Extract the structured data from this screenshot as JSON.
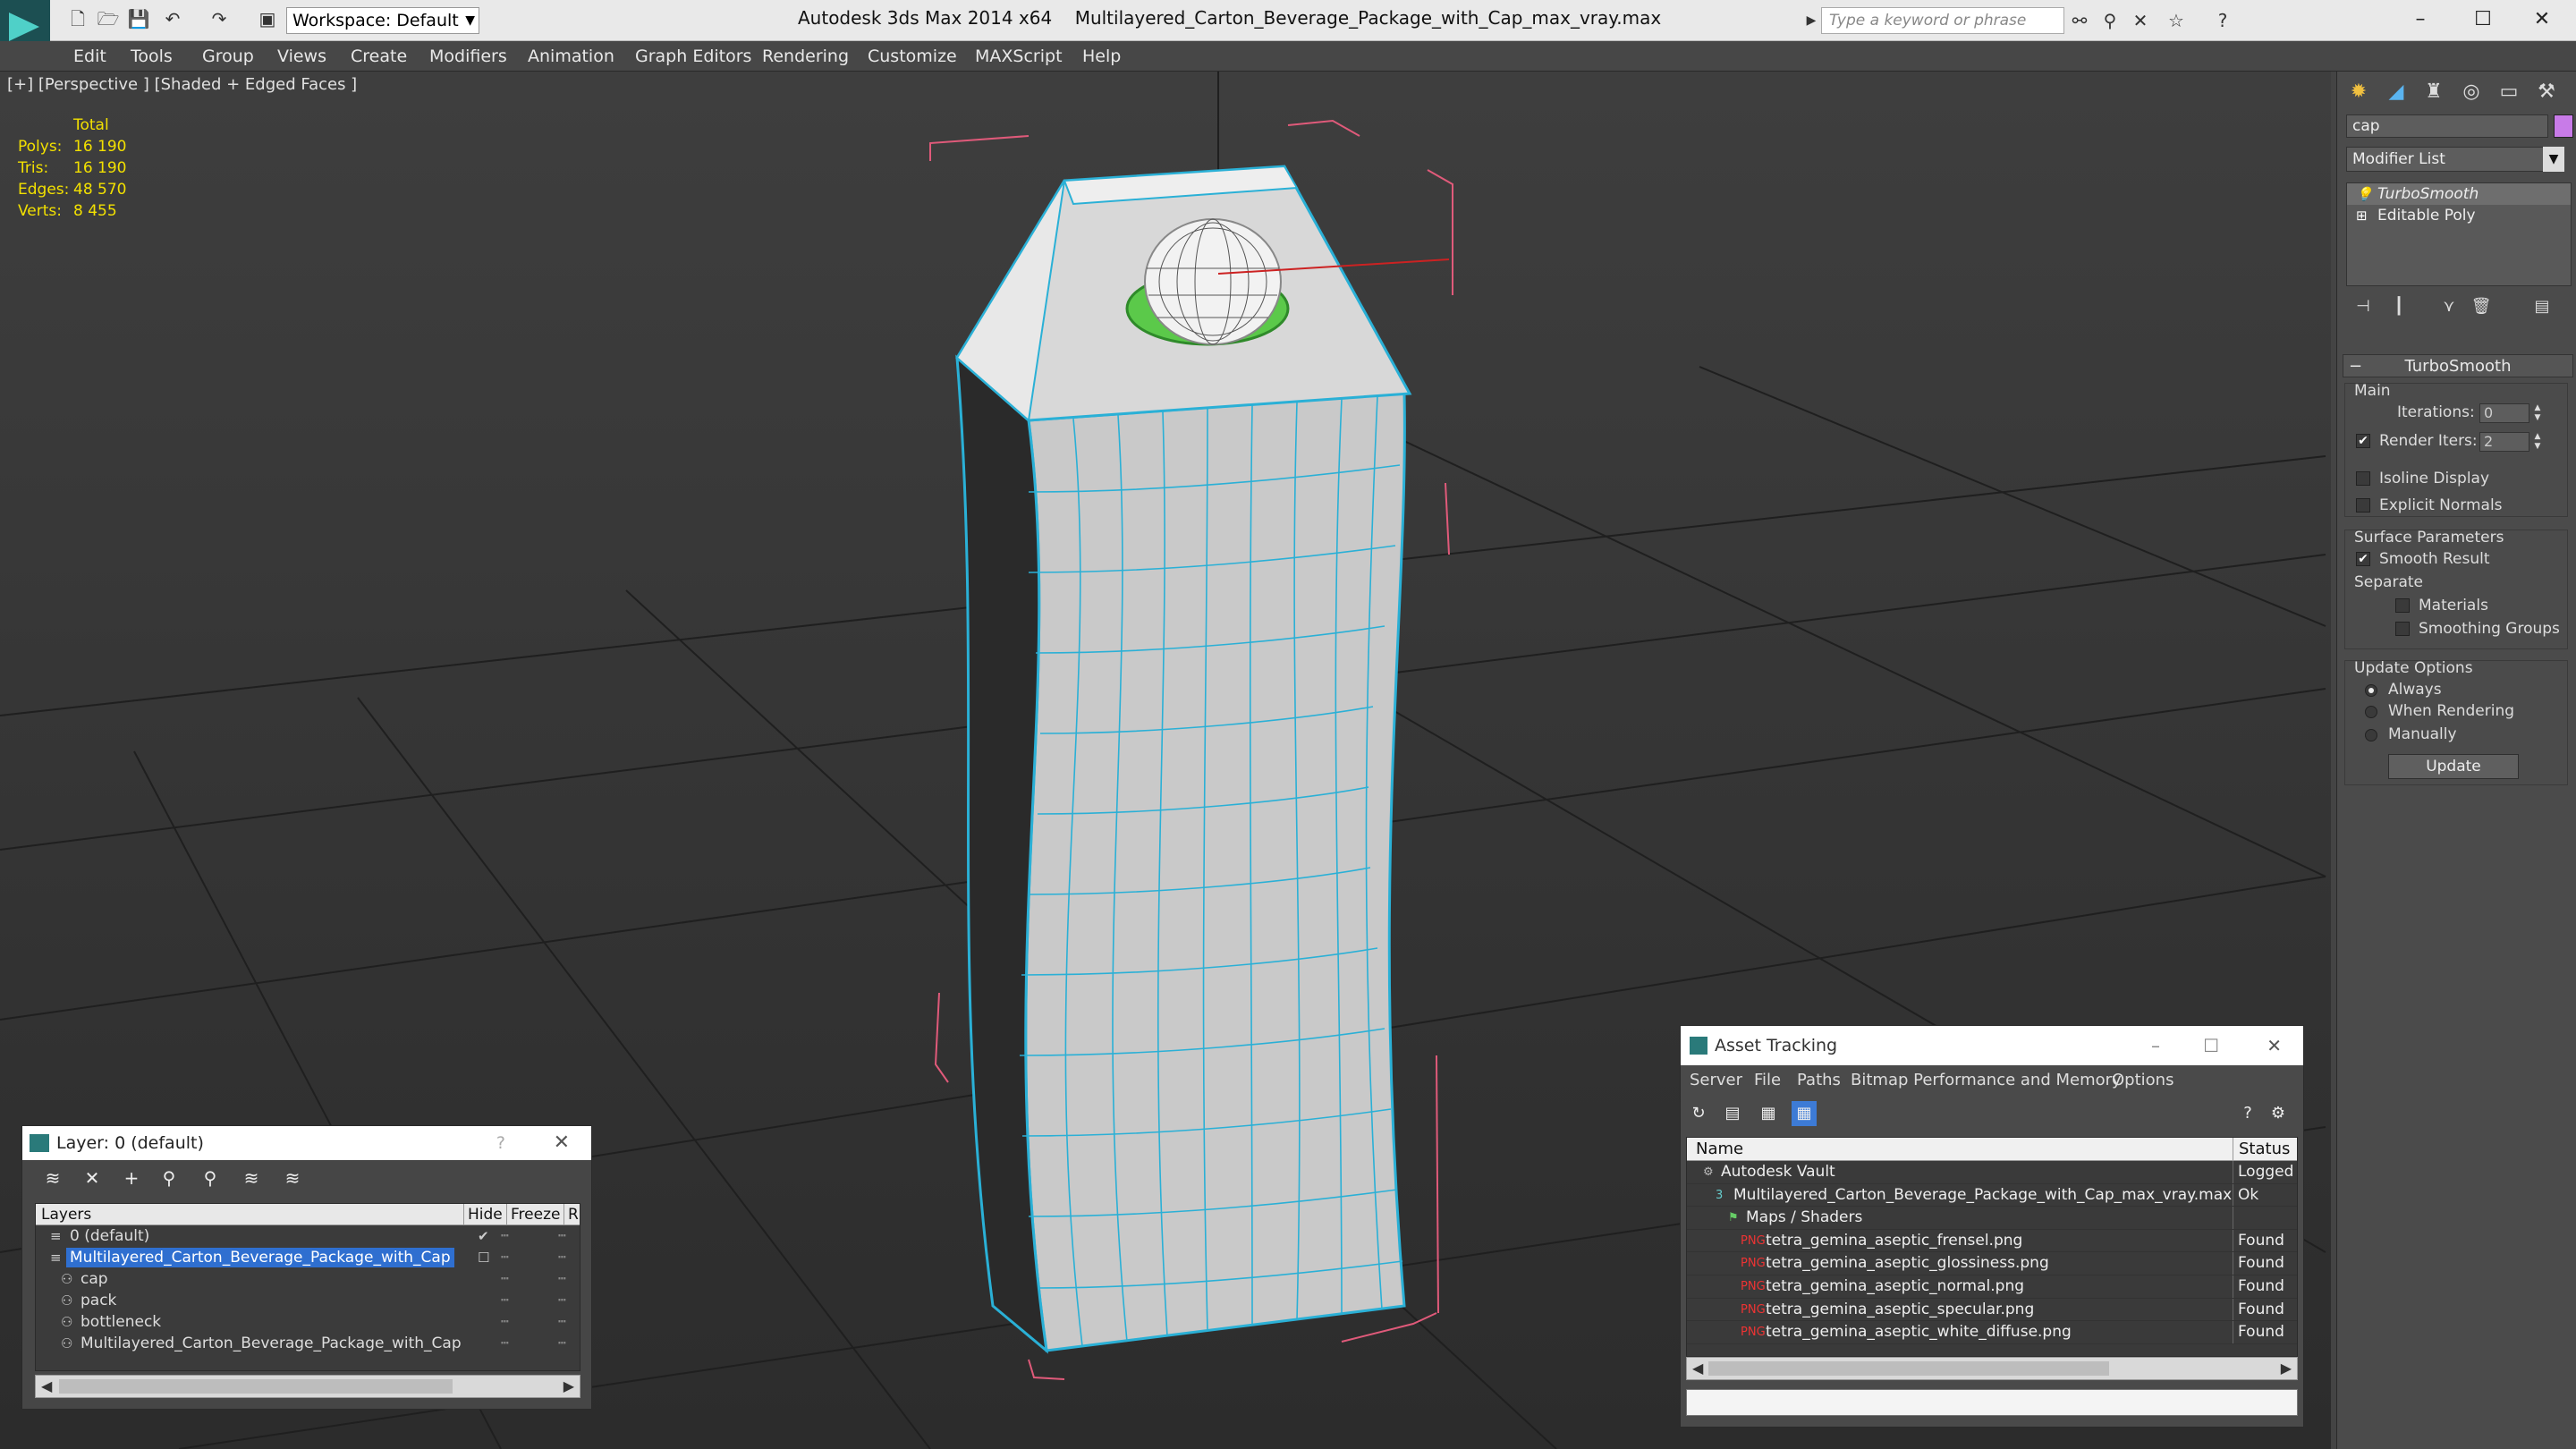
{
  "titlebar": {
    "workspace": "Workspace: Default",
    "app_name": "Autodesk 3ds Max  2014 x64",
    "file_name": "Multilayered_Carton_Beverage_Package_with_Cap_max_vray.max",
    "search_placeholder": "Type a keyword or phrase"
  },
  "menu": [
    "Edit",
    "Tools",
    "Group",
    "Views",
    "Create",
    "Modifiers",
    "Animation",
    "Graph Editors",
    "Rendering",
    "Customize",
    "MAXScript",
    "Help"
  ],
  "viewport": {
    "label": "[+] [Perspective ] [Shaded + Edged Faces ]",
    "stats": {
      "header": "Total",
      "rows": [
        {
          "k": "Polys:",
          "v": "16 190"
        },
        {
          "k": "Tris:",
          "v": "16 190"
        },
        {
          "k": "Edges:",
          "v": "48 570"
        },
        {
          "k": "Verts:",
          "v": "8 455"
        }
      ]
    }
  },
  "command_panel": {
    "object_name": "cap",
    "object_color": "#c87be8",
    "modifier_list": "Modifier List",
    "stack": [
      "TurboSmooth",
      "Editable Poly"
    ],
    "rollout_title": "TurboSmooth",
    "main_group": "Main",
    "iterations_label": "Iterations:",
    "iterations_value": "0",
    "render_iters_label": "Render Iters:",
    "render_iters_value": "2",
    "isoline_display": "Isoline Display",
    "explicit_normals": "Explicit Normals",
    "surface_params": "Surface Parameters",
    "smooth_result": "Smooth Result",
    "separate": "Separate",
    "materials": "Materials",
    "smoothing_groups": "Smoothing Groups",
    "update_options": "Update Options",
    "always": "Always",
    "when_rendering": "When Rendering",
    "manually": "Manually",
    "update_button": "Update"
  },
  "layer_dialog": {
    "title": "Layer: 0 (default)",
    "help": "?",
    "columns": {
      "layers": "Layers",
      "hide": "Hide",
      "freeze": "Freeze",
      "r": "R"
    },
    "rows": [
      {
        "name": "0 (default)",
        "indent": 0,
        "icon": "layer",
        "selected": false,
        "checked": true
      },
      {
        "name": "Multilayered_Carton_Beverage_Package_with_Cap",
        "indent": 0,
        "icon": "layer",
        "selected": true,
        "checked": false
      },
      {
        "name": "cap",
        "indent": 1,
        "icon": "object",
        "selected": false,
        "checked": false
      },
      {
        "name": "pack",
        "indent": 1,
        "icon": "object",
        "selected": false,
        "checked": false
      },
      {
        "name": "bottleneck",
        "indent": 1,
        "icon": "object",
        "selected": false,
        "checked": false
      },
      {
        "name": "Multilayered_Carton_Beverage_Package_with_Cap",
        "indent": 1,
        "icon": "object",
        "selected": false,
        "checked": false
      }
    ]
  },
  "asset_dialog": {
    "title": "Asset Tracking",
    "menu": [
      "Server",
      "File",
      "Paths",
      "Bitmap Performance and Memory",
      "Options"
    ],
    "columns": {
      "name": "Name",
      "status": "Status"
    },
    "rows": [
      {
        "name": "Autodesk Vault",
        "indent": 0,
        "icon": "vault",
        "status": "Logged"
      },
      {
        "name": "Multilayered_Carton_Beverage_Package_with_Cap_max_vray.max",
        "indent": 1,
        "icon": "max-file",
        "status": "Ok"
      },
      {
        "name": "Maps / Shaders",
        "indent": 2,
        "icon": "maps",
        "status": ""
      },
      {
        "name": "tetra_gemina_aseptic_frensel.png",
        "indent": 3,
        "icon": "png",
        "status": "Found"
      },
      {
        "name": "tetra_gemina_aseptic_glossiness.png",
        "indent": 3,
        "icon": "png",
        "status": "Found"
      },
      {
        "name": "tetra_gemina_aseptic_normal.png",
        "indent": 3,
        "icon": "png",
        "status": "Found"
      },
      {
        "name": "tetra_gemina_aseptic_specular.png",
        "indent": 3,
        "icon": "png",
        "status": "Found"
      },
      {
        "name": "tetra_gemina_aseptic_white_diffuse.png",
        "indent": 3,
        "icon": "png",
        "status": "Found"
      }
    ]
  }
}
